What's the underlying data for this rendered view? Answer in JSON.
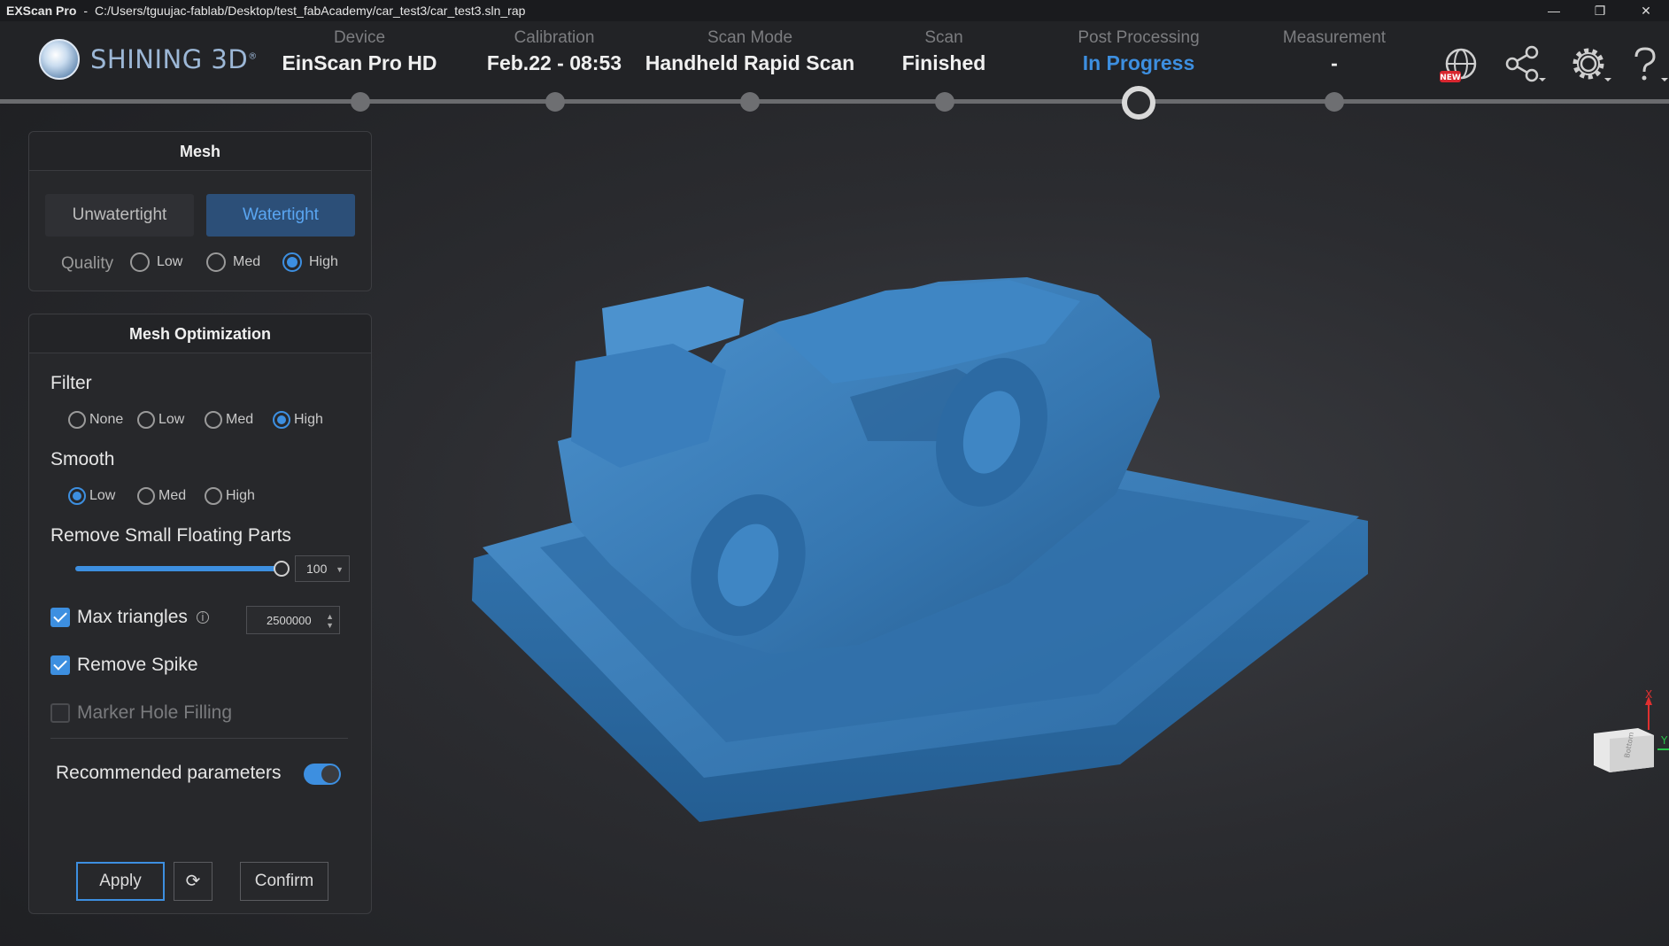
{
  "titlebar": {
    "app_name": "EXScan Pro",
    "separator": "-",
    "path": "C:/Users/tguujac-fablab/Desktop/test_fabAcademy/car_test3/car_test3.sln_rap",
    "minimize": "—",
    "restore": "❐",
    "close": "✕"
  },
  "logo": {
    "text": "SHINING 3D",
    "mark": "®"
  },
  "steps": [
    {
      "label": "Device",
      "value": "EinScan Pro HD"
    },
    {
      "label": "Calibration",
      "value": "Feb.22 - 08:53"
    },
    {
      "label": "Scan Mode",
      "value": "Handheld Rapid Scan"
    },
    {
      "label": "Scan",
      "value": "Finished"
    },
    {
      "label": "Post Processing",
      "value": "In Progress",
      "active": true
    },
    {
      "label": "Measurement",
      "value": "-"
    }
  ],
  "header_icons": {
    "new_badge": "NEW",
    "icons": [
      "update-globe-icon",
      "share-icon",
      "settings-gear-icon",
      "help-icon"
    ]
  },
  "mesh_panel": {
    "title": "Mesh",
    "modes": [
      "Unwatertight",
      "Watertight"
    ],
    "selected_mode": "Watertight",
    "quality_label": "Quality",
    "quality_options": [
      "Low",
      "Med",
      "High"
    ],
    "quality_selected": "High"
  },
  "optimization_panel": {
    "title": "Mesh Optimization",
    "filter_label": "Filter",
    "filter_options": [
      "None",
      "Low",
      "Med",
      "High"
    ],
    "filter_selected": "High",
    "smooth_label": "Smooth",
    "smooth_options": [
      "Low",
      "Med",
      "High"
    ],
    "smooth_selected": "Low",
    "floating_label": "Remove Small Floating Parts",
    "floating_value": "100",
    "floating_level": 1.0,
    "max_triangles_label": "Max triangles",
    "max_triangles_value": "2500000",
    "max_triangles_checked": true,
    "remove_spike_label": "Remove Spike",
    "remove_spike_checked": true,
    "marker_hole_label": "Marker Hole Filling",
    "marker_hole_checked": false,
    "recommended_label": "Recommended parameters",
    "recommended_on": true,
    "apply_label": "Apply",
    "reset_icon": "⟳",
    "confirm_label": "Confirm"
  },
  "viewport": {
    "model_color": "#3a7bb5",
    "axis_x": "X",
    "axis_y": "Y",
    "cube_face": "Bottom"
  },
  "colors": {
    "accent": "#3d8fe0",
    "background": "#2b2c30"
  }
}
